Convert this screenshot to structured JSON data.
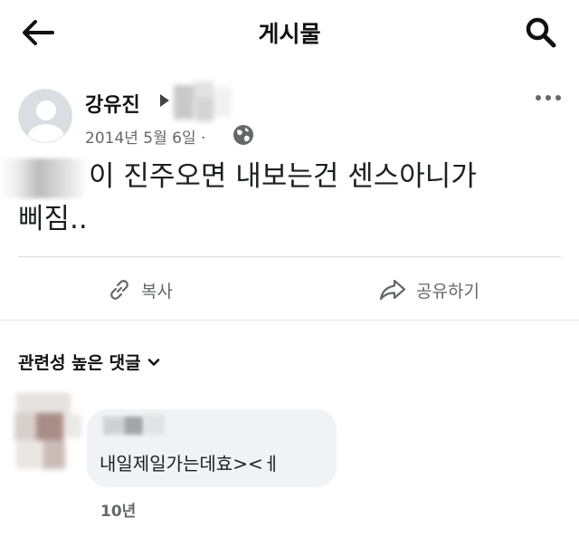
{
  "topbar": {
    "title": "게시물",
    "back_icon": "arrow-left-icon",
    "search_icon": "search-icon"
  },
  "post": {
    "author": "강유진",
    "date": "2014년 5월 6일 ·",
    "audience_icon": "globe-icon",
    "body_line1": "이 진주오면 내보는건 센스아니가",
    "body_line2": "삐짐..",
    "actions": {
      "copy_label": "복사",
      "share_label": "공유하기"
    }
  },
  "comments": {
    "sort_label": "관련성 높은 댓글",
    "items": [
      {
        "text": "내일제일가는데효><ㅔ",
        "time": "10년"
      }
    ]
  },
  "colors": {
    "text_primary": "#1c1e21",
    "text_secondary": "#65676b",
    "bubble_bg": "#f0f2f5",
    "divider": "#dadde1"
  }
}
